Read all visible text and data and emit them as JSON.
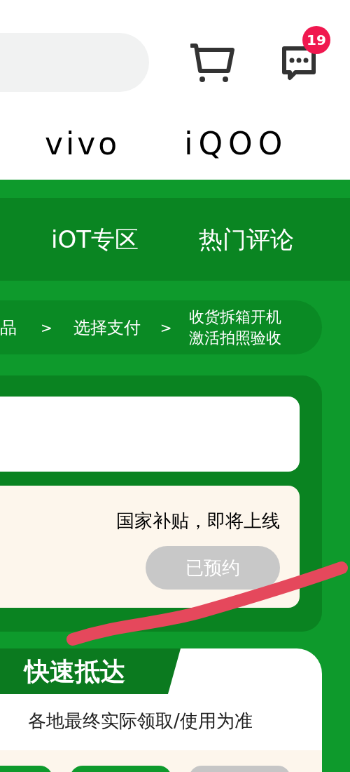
{
  "header": {
    "message_badge": "19",
    "brands": [
      "vivo",
      "iQOO"
    ]
  },
  "tabs": [
    "iOT专区",
    "热门评论"
  ],
  "steps": [
    {
      "kind": "step",
      "lines": [
        "品"
      ]
    },
    {
      "kind": "arrow",
      "lines": [
        ">"
      ]
    },
    {
      "kind": "step",
      "lines": [
        "选择支付"
      ]
    },
    {
      "kind": "arrow",
      "lines": [
        ">"
      ]
    },
    {
      "kind": "step",
      "lines": [
        "收货拆箱开机",
        "激活拍照验收"
      ]
    }
  ],
  "subsidy": {
    "notice": "国家补贴，即将上线",
    "button": {
      "label": "已预约",
      "disabled": true
    }
  },
  "delivery": {
    "title": "快速抵达",
    "note": "各地最终实际领取/使用为准"
  }
}
